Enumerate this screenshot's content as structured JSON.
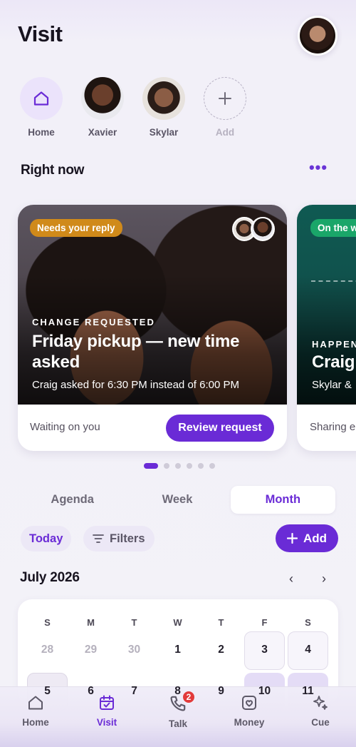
{
  "header": {
    "title": "Visit",
    "profile_avatar": "user-avatar"
  },
  "people": [
    {
      "label": "Home",
      "icon": "home-icon"
    },
    {
      "label": "Xavier",
      "avatar": "xavier-avatar"
    },
    {
      "label": "Skylar",
      "avatar": "skylar-avatar"
    },
    {
      "label": "Add",
      "icon": "plus-icon"
    }
  ],
  "right_now": {
    "title": "Right now",
    "more_icon": "ellipsis-icon",
    "more_label": "•••",
    "cards": [
      {
        "badge": "Needs your reply",
        "badge_color": "#d08a1a",
        "eyebrow": "CHANGE REQUESTED",
        "headline": "Friday pickup — new time asked",
        "subline": "Craig asked for 6:30 PM instead of 6:00 PM",
        "footer": "Waiting on you",
        "action": "Review request"
      },
      {
        "badge": "On the w",
        "badge_color": "#1aa669",
        "eyebrow": "HAPPEN",
        "headline": "Craig",
        "subline": "Skylar &",
        "footer": "Sharing e"
      }
    ],
    "carousel": {
      "total": 6,
      "active_index": 0
    }
  },
  "calendar_tabs": {
    "items": [
      "Agenda",
      "Week",
      "Month"
    ],
    "active": "Month"
  },
  "toolbar": {
    "today": "Today",
    "filters": "Filters",
    "add": "Add"
  },
  "month": {
    "title": "July 2026",
    "prev": "‹",
    "next": "›",
    "weekdays": [
      "S",
      "M",
      "T",
      "W",
      "T",
      "F",
      "S"
    ],
    "weeks": [
      [
        "28",
        "29",
        "30",
        "1",
        "2",
        "3",
        "4"
      ],
      [
        "5",
        "6",
        "7",
        "8",
        "9",
        "10",
        "11"
      ]
    ]
  },
  "bottom_nav": {
    "items": [
      {
        "label": "Home",
        "icon": "home-icon"
      },
      {
        "label": "Visit",
        "icon": "calendar-check-icon"
      },
      {
        "label": "Talk",
        "icon": "phone-icon",
        "badge": "2"
      },
      {
        "label": "Money",
        "icon": "wallet-icon"
      },
      {
        "label": "Cue",
        "icon": "sparkle-icon"
      }
    ],
    "active": "Visit"
  },
  "colors": {
    "accent": "#6a2bd6",
    "warning": "#d08a1a",
    "success": "#1aa669",
    "badge": "#e23a3a"
  }
}
